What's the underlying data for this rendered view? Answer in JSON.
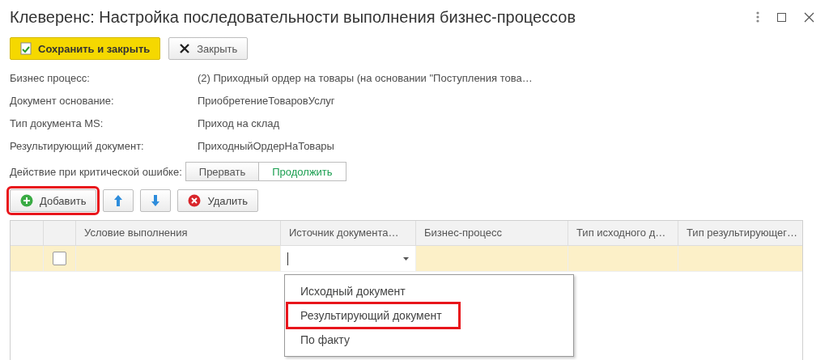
{
  "window": {
    "title": "Клеверенс: Настройка последовательности выполнения бизнес-процессов"
  },
  "command_bar": [
    {
      "kind": "save",
      "label": "Сохранить и закрыть"
    },
    {
      "kind": "close",
      "label": "Закрыть"
    }
  ],
  "fields": [
    {
      "label": "Бизнес процесс:",
      "value": "(2) Приходный ордер на товары (на основании \"Поступления това…"
    },
    {
      "label": "Документ основание:",
      "value": "ПриобретениеТоваровУслуг"
    },
    {
      "label": "Тип документа MS:",
      "value": "Приход на склад"
    },
    {
      "label": "Результирующий документ:",
      "value": "ПриходныйОрдерНаТовары"
    }
  ],
  "critical_error": {
    "label": "Действие при критической ошибке:",
    "options": [
      {
        "label": "Прервать",
        "selected": false
      },
      {
        "label": "Продолжить",
        "selected": true
      }
    ]
  },
  "toolbar": [
    {
      "kind": "add",
      "label": "Добавить",
      "highlighted": true
    },
    {
      "kind": "up",
      "highlighted": false
    },
    {
      "kind": "down",
      "highlighted": false
    },
    {
      "kind": "delete",
      "label": "Удалить",
      "highlighted": false
    }
  ],
  "table": {
    "columns": [
      "Условие выполнения",
      "Источник документа…",
      "Бизнес-процесс",
      "Тип исходного д…",
      "Тип результирующег…"
    ],
    "rows": [
      {
        "selected": true,
        "checked": false,
        "cells": [
          {
            "editing": false
          },
          {
            "editing": true
          },
          {
            "editing": false
          },
          {
            "editing": false
          },
          {
            "editing": false
          }
        ]
      }
    ]
  },
  "dropdown": {
    "items": [
      {
        "label": "Исходный документ",
        "highlighted": false
      },
      {
        "label": "Результирующий документ",
        "highlighted": true
      },
      {
        "label": "По факту",
        "highlighted": false
      }
    ]
  }
}
